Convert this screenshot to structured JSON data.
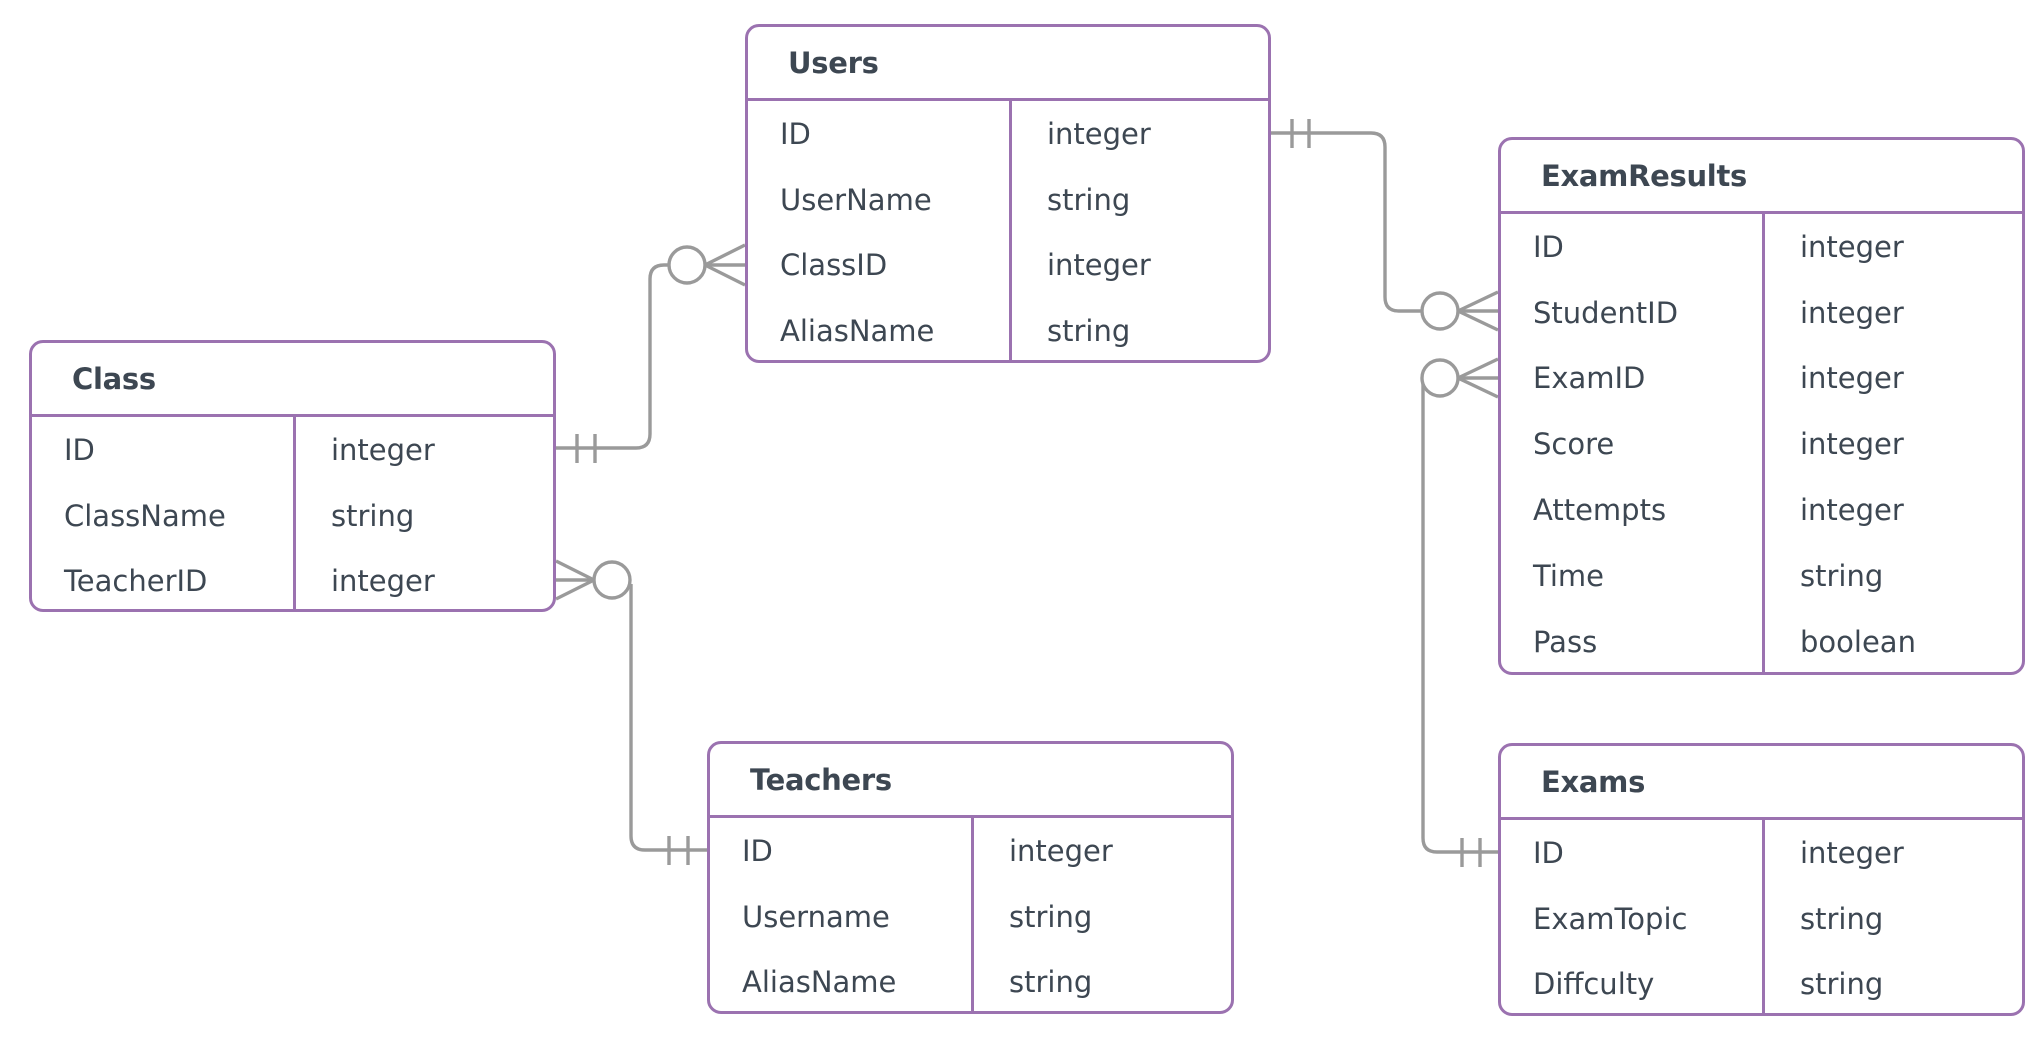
{
  "diagram": {
    "type": "entity-relationship",
    "colors": {
      "entity_border": "#9b72b0",
      "connector": "#9a9a9a",
      "text": "#3d4752"
    },
    "entities": [
      {
        "id": "users",
        "title": "Users",
        "fields": [
          {
            "name": "ID",
            "type": "integer"
          },
          {
            "name": "UserName",
            "type": "string"
          },
          {
            "name": "ClassID",
            "type": "integer"
          },
          {
            "name": "AliasName",
            "type": "string"
          }
        ]
      },
      {
        "id": "class",
        "title": "Class",
        "fields": [
          {
            "name": "ID",
            "type": "integer"
          },
          {
            "name": "ClassName",
            "type": "string"
          },
          {
            "name": "TeacherID",
            "type": "integer"
          }
        ]
      },
      {
        "id": "teachers",
        "title": "Teachers",
        "fields": [
          {
            "name": "ID",
            "type": "integer"
          },
          {
            "name": "Username",
            "type": "string"
          },
          {
            "name": "AliasName",
            "type": "string"
          }
        ]
      },
      {
        "id": "examresults",
        "title": "ExamResults",
        "fields": [
          {
            "name": "ID",
            "type": "integer"
          },
          {
            "name": "StudentID",
            "type": "integer"
          },
          {
            "name": "ExamID",
            "type": "integer"
          },
          {
            "name": "Score",
            "type": "integer"
          },
          {
            "name": "Attempts",
            "type": "integer"
          },
          {
            "name": "Time",
            "type": "string"
          },
          {
            "name": "Pass",
            "type": "boolean"
          }
        ]
      },
      {
        "id": "exams",
        "title": "Exams",
        "fields": [
          {
            "name": "ID",
            "type": "integer"
          },
          {
            "name": "ExamTopic",
            "type": "string"
          },
          {
            "name": "Diffculty",
            "type": "string"
          }
        ]
      }
    ],
    "relationships": [
      {
        "from": "Class.ID",
        "from_cardinality": "exactly-one",
        "to": "Users.ClassID",
        "to_cardinality": "zero-or-many"
      },
      {
        "from": "Users.ID",
        "from_cardinality": "exactly-one",
        "to": "ExamResults.StudentID",
        "to_cardinality": "zero-or-many"
      },
      {
        "from": "Teachers.ID",
        "from_cardinality": "exactly-one",
        "to": "Class.TeacherID",
        "to_cardinality": "zero-or-many"
      },
      {
        "from": "Exams.ID",
        "from_cardinality": "exactly-one",
        "to": "ExamResults.ExamID",
        "to_cardinality": "zero-or-many"
      }
    ]
  }
}
